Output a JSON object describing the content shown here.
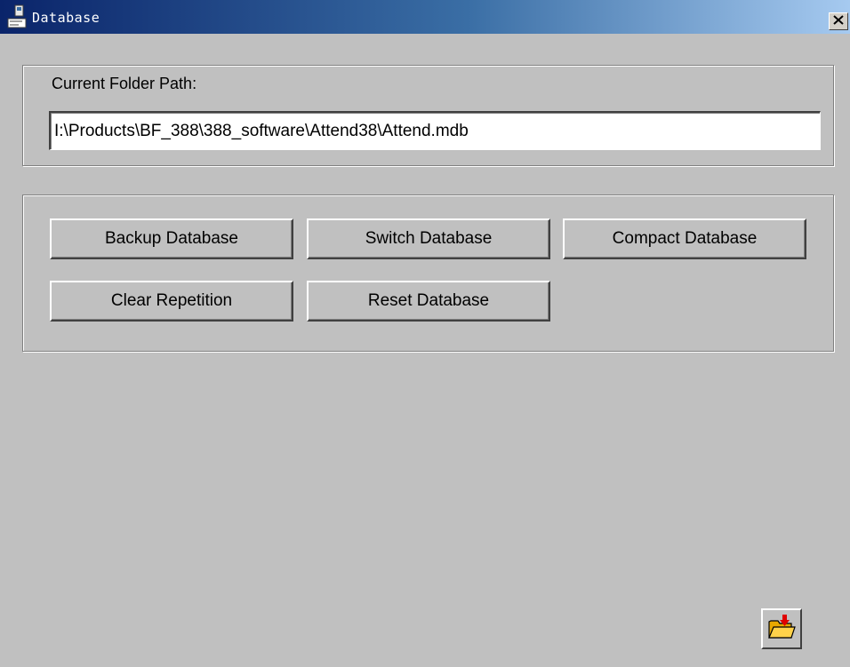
{
  "window": {
    "title": "Database",
    "title_icon": "database-app-icon",
    "close_icon": "close-icon"
  },
  "path_group": {
    "label": "Current Folder Path:",
    "value": "I:\\Products\\BF_388\\388_software\\Attend38\\Attend.mdb"
  },
  "actions": {
    "backup": "Backup Database",
    "switch": "Switch Database",
    "compact": "Compact Database",
    "clear_repetition": "Clear Repetition",
    "reset": "Reset Database"
  },
  "footer": {
    "open_icon": "open-folder-icon"
  },
  "colors": {
    "titlebar_start": "#0a246a",
    "titlebar_end": "#a6caf0",
    "face": "#c0c0c0"
  }
}
